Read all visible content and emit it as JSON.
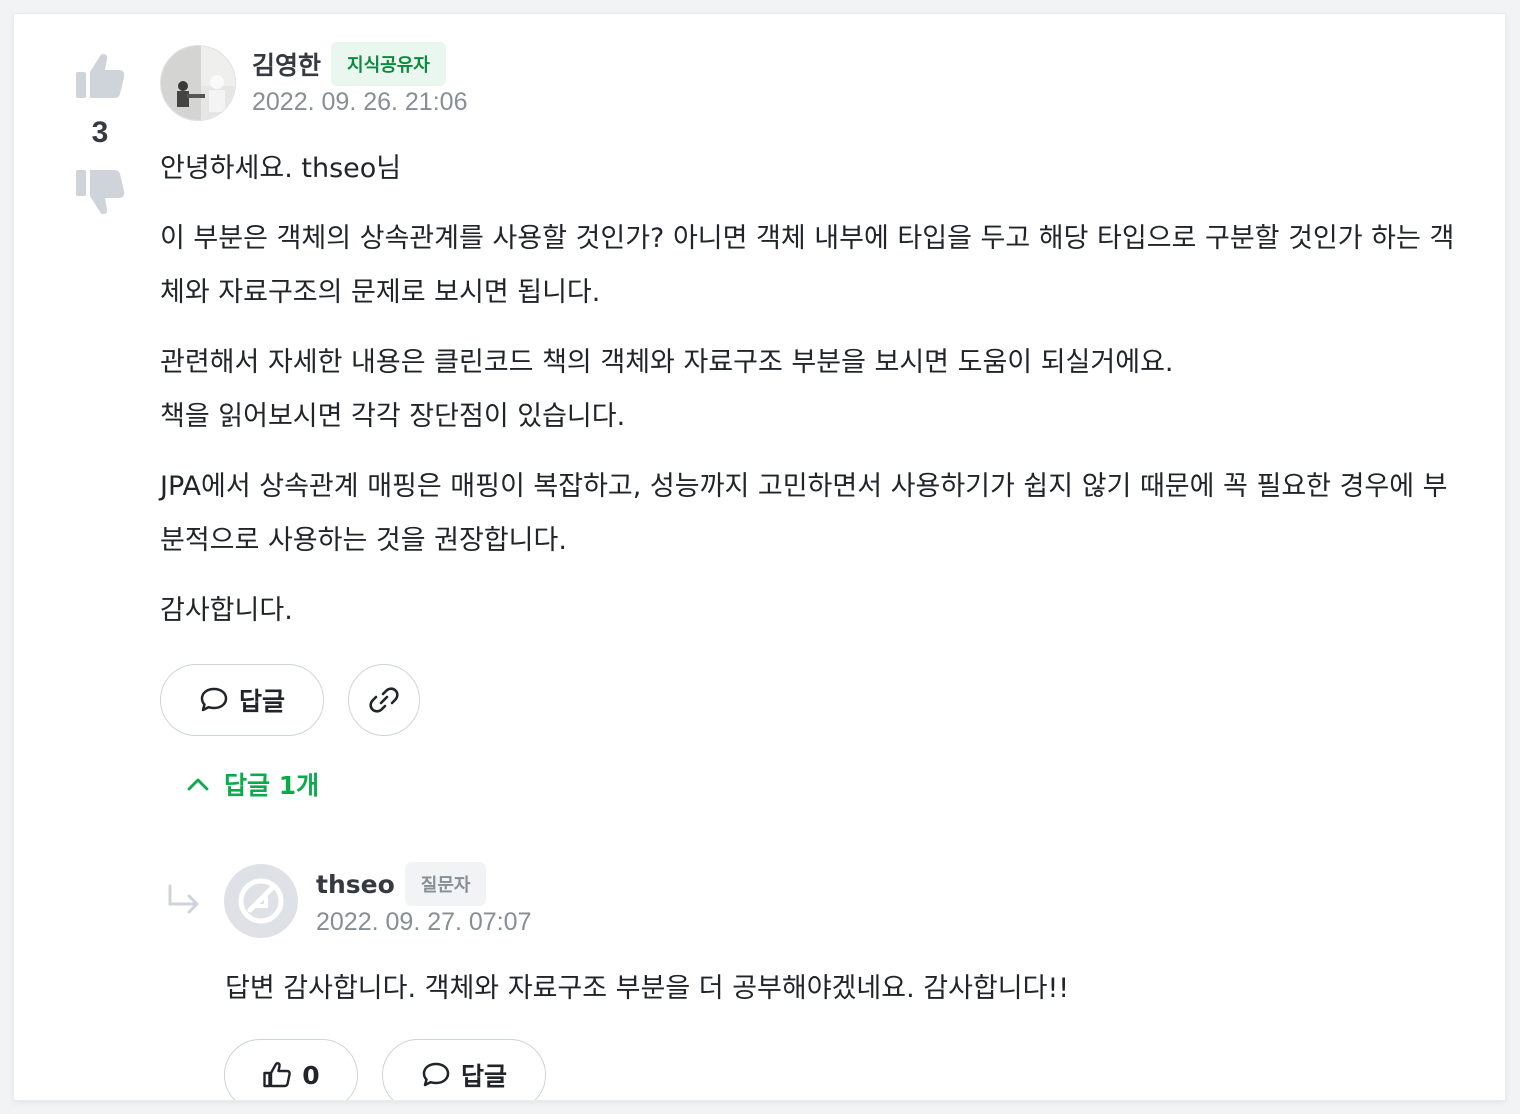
{
  "answer": {
    "vote_count": "3",
    "author": "김영한",
    "author_badge": "지식공유자",
    "date": "2022. 09. 26. 21:06",
    "paragraphs": [
      "안녕하세요. thseo님",
      "이 부분은 객체의 상속관계를 사용할 것인가? 아니면 객체 내부에 타입을 두고 해당 타입으로 구분할 것인가 하는 객체와 자료구조의 문제로 보시면 됩니다.",
      "관련해서 자세한 내용은 클린코드 책의 객체와 자료구조 부분을 보시면 도움이 되실거에요.",
      "책을 읽어보시면 각각 장단점이 있습니다.",
      "JPA에서 상속관계 매핑은 매핑이 복잡하고, 성능까지 고민하면서 사용하기가 쉽지 않기 때문에 꼭 필요한 경우에 부분적으로 사용하는 것을 권장합니다.",
      "감사합니다."
    ],
    "reply_button_label": "답글",
    "replies_toggle_label": "답글 1개"
  },
  "reply": {
    "author": "thseo",
    "author_badge": "질문자",
    "date": "2022. 09. 27. 07:07",
    "text": "답변 감사합니다. 객체와 자료구조 부분을 더 공부해야겠네요. 감사합니다!!",
    "like_count": "0",
    "reply_button_label": "답글"
  },
  "colors": {
    "accent_green": "#0bab4d",
    "badge_green_bg": "#e9f7ee",
    "muted_gray": "#868e96",
    "icon_gray": "#ced4da"
  },
  "icons": [
    "thumbs-up-icon",
    "thumbs-down-icon",
    "comment-icon",
    "link-icon",
    "chevron-up-icon",
    "reply-arrow-icon",
    "default-avatar-icon"
  ]
}
